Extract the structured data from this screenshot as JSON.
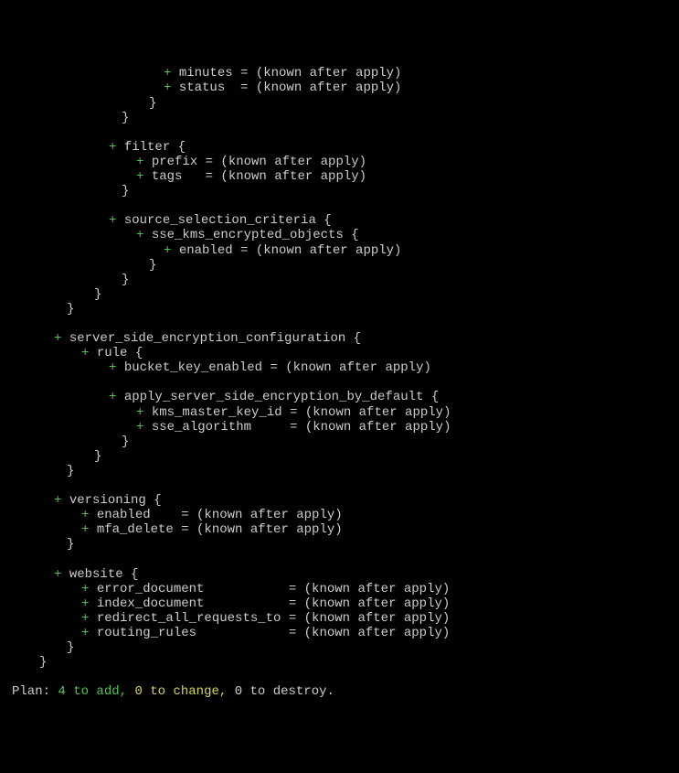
{
  "terminal": {
    "lines": [
      {
        "indent": 179,
        "plus": true,
        "text": "minutes = (known after apply)"
      },
      {
        "indent": 179,
        "plus": true,
        "text": "status  = (known after apply)"
      },
      {
        "indent": 163,
        "plain": true,
        "text": "}"
      },
      {
        "indent": 133,
        "plain": true,
        "text": "}"
      },
      {
        "blank": true
      },
      {
        "indent": 119,
        "plus": true,
        "text": "filter {"
      },
      {
        "indent": 149,
        "plus": true,
        "text": "prefix = (known after apply)"
      },
      {
        "indent": 149,
        "plus": true,
        "text": "tags   = (known after apply)"
      },
      {
        "indent": 133,
        "plain": true,
        "text": "}"
      },
      {
        "blank": true
      },
      {
        "indent": 119,
        "plus": true,
        "text": "source_selection_criteria {"
      },
      {
        "indent": 149,
        "plus": true,
        "text": "sse_kms_encrypted_objects {"
      },
      {
        "indent": 179,
        "plus": true,
        "text": "enabled = (known after apply)"
      },
      {
        "indent": 163,
        "plain": true,
        "text": "}"
      },
      {
        "indent": 133,
        "plain": true,
        "text": "}"
      },
      {
        "indent": 103,
        "plain": true,
        "text": "}"
      },
      {
        "indent": 73,
        "plain": true,
        "text": "}"
      },
      {
        "blank": true
      },
      {
        "indent": 59,
        "plus": true,
        "text": "server_side_encryption_configuration {"
      },
      {
        "indent": 89,
        "plus": true,
        "text": "rule {"
      },
      {
        "indent": 119,
        "plus": true,
        "text": "bucket_key_enabled = (known after apply)"
      },
      {
        "blank": true
      },
      {
        "indent": 119,
        "plus": true,
        "text": "apply_server_side_encryption_by_default {"
      },
      {
        "indent": 149,
        "plus": true,
        "text": "kms_master_key_id = (known after apply)"
      },
      {
        "indent": 149,
        "plus": true,
        "text": "sse_algorithm     = (known after apply)"
      },
      {
        "indent": 133,
        "plain": true,
        "text": "}"
      },
      {
        "indent": 103,
        "plain": true,
        "text": "}"
      },
      {
        "indent": 73,
        "plain": true,
        "text": "}"
      },
      {
        "blank": true
      },
      {
        "indent": 59,
        "plus": true,
        "text": "versioning {"
      },
      {
        "indent": 89,
        "plus": true,
        "text": "enabled    = (known after apply)"
      },
      {
        "indent": 89,
        "plus": true,
        "text": "mfa_delete = (known after apply)"
      },
      {
        "indent": 73,
        "plain": true,
        "text": "}"
      },
      {
        "blank": true
      },
      {
        "indent": 59,
        "plus": true,
        "text": "website {"
      },
      {
        "indent": 89,
        "plus": true,
        "text": "error_document           = (known after apply)"
      },
      {
        "indent": 89,
        "plus": true,
        "text": "index_document           = (known after apply)"
      },
      {
        "indent": 89,
        "plus": true,
        "text": "redirect_all_requests_to = (known after apply)"
      },
      {
        "indent": 89,
        "plus": true,
        "text": "routing_rules            = (known after apply)"
      },
      {
        "indent": 73,
        "plain": true,
        "text": "}"
      },
      {
        "indent": 43,
        "plain": true,
        "text": "}"
      }
    ],
    "plan": {
      "prefix": "Plan:",
      "add": "4 to add,",
      "change": "0 to change,",
      "destroy": "0 to destroy."
    }
  }
}
